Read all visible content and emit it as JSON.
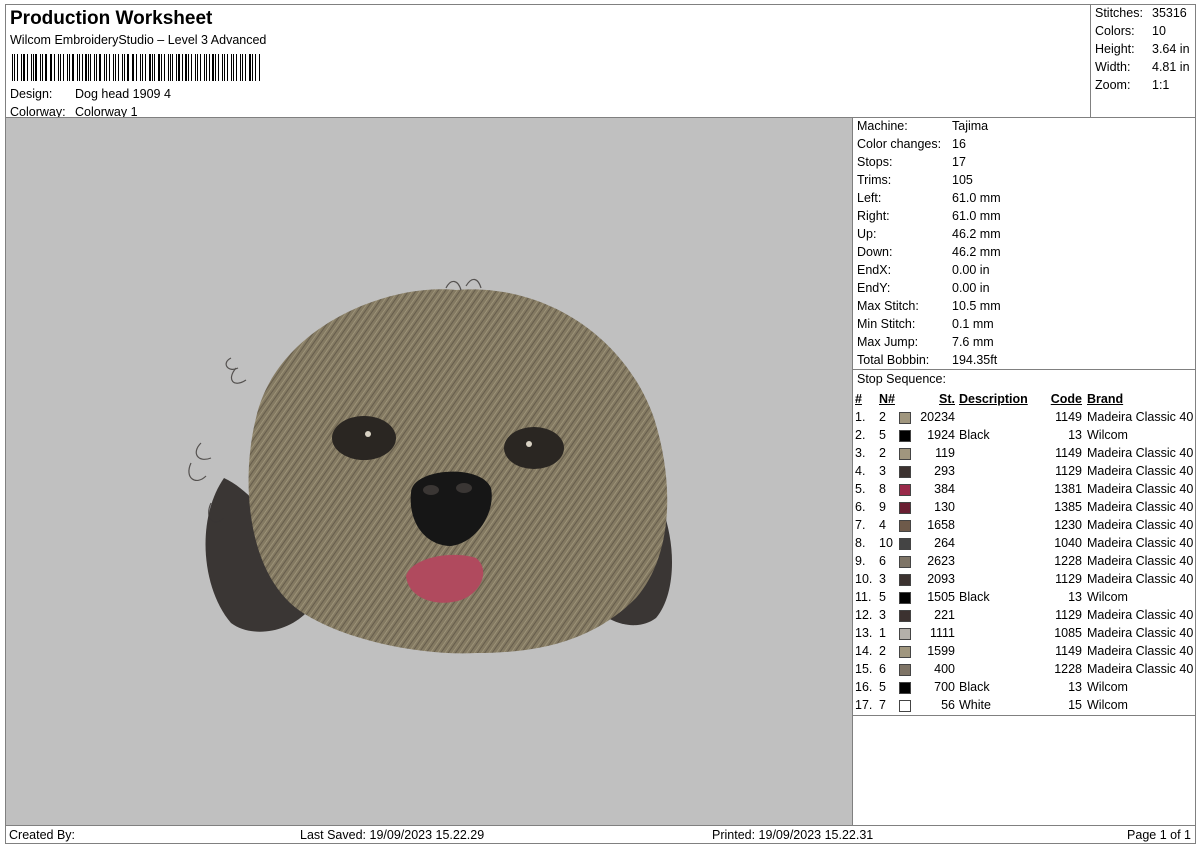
{
  "header": {
    "title": "Production Worksheet",
    "software": "Wilcom EmbroideryStudio – Level 3 Advanced",
    "design_label": "Design:",
    "design_value": "Dog head 1909 4",
    "colorway_label": "Colorway:",
    "colorway_value": "Colorway 1"
  },
  "summary": [
    {
      "label": "Stitches:",
      "value": "35316"
    },
    {
      "label": "Colors:",
      "value": "10"
    },
    {
      "label": "Height:",
      "value": "3.64 in"
    },
    {
      "label": "Width:",
      "value": "4.81 in"
    },
    {
      "label": "Zoom:",
      "value": "1:1"
    }
  ],
  "machine": [
    {
      "label": "Machine:",
      "value": "Tajima"
    },
    {
      "label": "Color changes:",
      "value": "16"
    },
    {
      "label": "Stops:",
      "value": "17"
    },
    {
      "label": "Trims:",
      "value": "105"
    },
    {
      "label": "Left:",
      "value": "61.0 mm"
    },
    {
      "label": "Right:",
      "value": "61.0 mm"
    },
    {
      "label": "Up:",
      "value": "46.2 mm"
    },
    {
      "label": "Down:",
      "value": "46.2 mm"
    },
    {
      "label": "EndX:",
      "value": "0.00 in"
    },
    {
      "label": "EndY:",
      "value": "0.00 in"
    },
    {
      "label": "Max Stitch:",
      "value": "10.5 mm"
    },
    {
      "label": "Min Stitch:",
      "value": "0.1 mm"
    },
    {
      "label": "Max Jump:",
      "value": "7.6 mm"
    },
    {
      "label": "Total Bobbin:",
      "value": "194.35ft"
    }
  ],
  "stop_sequence": {
    "title": "Stop Sequence:",
    "headers": {
      "num": "#",
      "n": "N#",
      "st": "St.",
      "desc": "Description",
      "code": "Code",
      "brand": "Brand"
    },
    "rows": [
      {
        "num": "1.",
        "n": "2",
        "color": "#a0967e",
        "st": "20234",
        "desc": "",
        "code": "1149",
        "brand": "Madeira Classic 40"
      },
      {
        "num": "2.",
        "n": "5",
        "color": "#000000",
        "st": "1924",
        "desc": "Black",
        "code": "13",
        "brand": "Wilcom"
      },
      {
        "num": "3.",
        "n": "2",
        "color": "#a0967e",
        "st": "119",
        "desc": "",
        "code": "1149",
        "brand": "Madeira Classic 40"
      },
      {
        "num": "4.",
        "n": "3",
        "color": "#3c3230",
        "st": "293",
        "desc": "",
        "code": "1129",
        "brand": "Madeira Classic 40"
      },
      {
        "num": "5.",
        "n": "8",
        "color": "#9a2a4a",
        "st": "384",
        "desc": "",
        "code": "1381",
        "brand": "Madeira Classic 40"
      },
      {
        "num": "6.",
        "n": "9",
        "color": "#6a1e32",
        "st": "130",
        "desc": "",
        "code": "1385",
        "brand": "Madeira Classic 40"
      },
      {
        "num": "7.",
        "n": "4",
        "color": "#6e5a4a",
        "st": "1658",
        "desc": "",
        "code": "1230",
        "brand": "Madeira Classic 40"
      },
      {
        "num": "8.",
        "n": "10",
        "color": "#444444",
        "st": "264",
        "desc": "",
        "code": "1040",
        "brand": "Madeira Classic 40"
      },
      {
        "num": "9.",
        "n": "6",
        "color": "#7e7466",
        "st": "2623",
        "desc": "",
        "code": "1228",
        "brand": "Madeira Classic 40"
      },
      {
        "num": "10.",
        "n": "3",
        "color": "#3c3230",
        "st": "2093",
        "desc": "",
        "code": "1129",
        "brand": "Madeira Classic 40"
      },
      {
        "num": "11.",
        "n": "5",
        "color": "#000000",
        "st": "1505",
        "desc": "Black",
        "code": "13",
        "brand": "Wilcom"
      },
      {
        "num": "12.",
        "n": "3",
        "color": "#3c3230",
        "st": "221",
        "desc": "",
        "code": "1129",
        "brand": "Madeira Classic 40"
      },
      {
        "num": "13.",
        "n": "1",
        "color": "#b4b0aa",
        "st": "1111",
        "desc": "",
        "code": "1085",
        "brand": "Madeira Classic 40"
      },
      {
        "num": "14.",
        "n": "2",
        "color": "#a0967e",
        "st": "1599",
        "desc": "",
        "code": "1149",
        "brand": "Madeira Classic 40"
      },
      {
        "num": "15.",
        "n": "6",
        "color": "#7e7466",
        "st": "400",
        "desc": "",
        "code": "1228",
        "brand": "Madeira Classic 40"
      },
      {
        "num": "16.",
        "n": "5",
        "color": "#000000",
        "st": "700",
        "desc": "Black",
        "code": "13",
        "brand": "Wilcom"
      },
      {
        "num": "17.",
        "n": "7",
        "color": "#ffffff",
        "st": "56",
        "desc": "White",
        "code": "15",
        "brand": "Wilcom"
      }
    ]
  },
  "footer": {
    "created_by": "Created By:",
    "last_saved": "Last Saved: 19/09/2023 15.22.29",
    "printed": "Printed: 19/09/2023 15.22.31",
    "page": "Page 1 of 1"
  },
  "preview": {
    "background": "#c0c0c0",
    "fur_color": "#847a62",
    "ear_color": "#3a3634",
    "nose_color": "#161616",
    "tongue_color": "#b04a5e"
  }
}
